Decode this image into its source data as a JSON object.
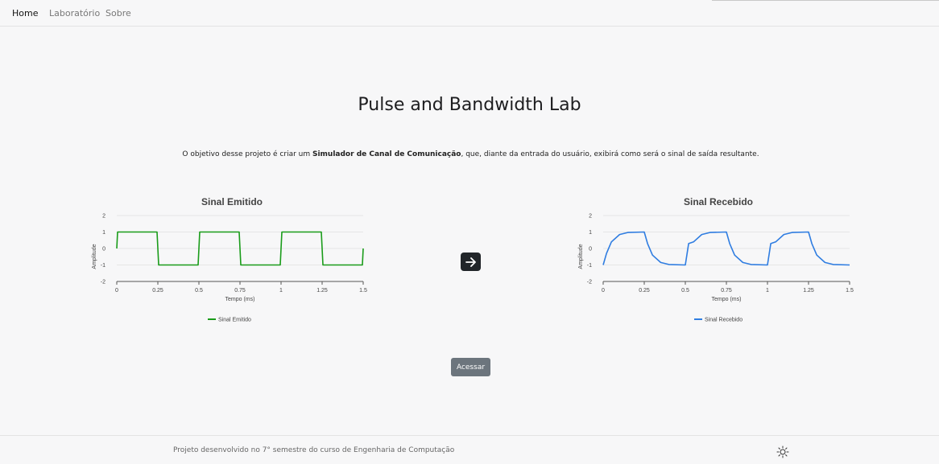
{
  "nav": {
    "items": [
      {
        "label": "Home",
        "active": true
      },
      {
        "label": "Laboratório",
        "active": false
      },
      {
        "label": "Sobre",
        "active": false
      }
    ]
  },
  "page": {
    "title": "Pulse and Bandwidth Lab",
    "description_prefix": "O objetivo desse projeto é criar um ",
    "description_bold": "Simulador de Canal de Comunicação",
    "description_suffix": ", que, diante da entrada do usuário, exibirá como será o sinal de saída resultante."
  },
  "actions": {
    "arrow_icon": "arrow-right-icon",
    "access_label": "Acessar"
  },
  "footer": {
    "text": "Projeto desenvolvido no 7° semestre do curso de Engenharia de Computação",
    "theme_icon": "sun-icon"
  },
  "chart_data": [
    {
      "type": "line",
      "title": "Sinal Emitido",
      "xlabel": "Tempo (ms)",
      "ylabel": "Amplitude",
      "xlim": [
        0,
        1.5
      ],
      "ylim": [
        -2,
        2
      ],
      "x_ticks": [
        "0",
        "0.25",
        "0.5",
        "0.75",
        "1",
        "1.25",
        "1.5"
      ],
      "y_ticks": [
        "2",
        "1",
        "0",
        "-1",
        "-2"
      ],
      "grid": true,
      "legend": "bottom",
      "series": [
        {
          "name": "Sinal Emitido",
          "color": "#1a9c1a",
          "x": [
            0,
            0.005,
            0.245,
            0.255,
            0.495,
            0.505,
            0.745,
            0.755,
            0.995,
            1.005,
            1.245,
            1.255,
            1.495,
            1.5
          ],
          "y": [
            0,
            1,
            1,
            -1,
            -1,
            1,
            1,
            -1,
            -1,
            1,
            1,
            -1,
            -1,
            0
          ]
        }
      ]
    },
    {
      "type": "line",
      "title": "Sinal Recebido",
      "xlabel": "Tempo (ms)",
      "ylabel": "Amplitude",
      "xlim": [
        0,
        1.5
      ],
      "ylim": [
        -2,
        2
      ],
      "x_ticks": [
        "0",
        "0.25",
        "0.5",
        "0.75",
        "1",
        "1.25",
        "1.5"
      ],
      "y_ticks": [
        "2",
        "1",
        "0",
        "-1",
        "-2"
      ],
      "grid": true,
      "legend": "bottom",
      "series": [
        {
          "name": "Sinal Recebido",
          "color": "#2f7de1",
          "x": [
            0,
            0.02,
            0.05,
            0.1,
            0.15,
            0.25,
            0.27,
            0.3,
            0.35,
            0.4,
            0.5,
            0.52,
            0.55,
            0.6,
            0.65,
            0.75,
            0.77,
            0.8,
            0.85,
            0.9,
            1.0,
            1.02,
            1.05,
            1.1,
            1.15,
            1.25,
            1.27,
            1.3,
            1.35,
            1.4,
            1.5
          ],
          "y": [
            -1,
            -0.3,
            0.4,
            0.85,
            0.97,
            1,
            0.3,
            -0.4,
            -0.85,
            -0.97,
            -1,
            0.3,
            0.4,
            0.85,
            0.97,
            1,
            0.3,
            -0.4,
            -0.85,
            -0.97,
            -1,
            0.3,
            0.4,
            0.85,
            0.97,
            1,
            0.3,
            -0.4,
            -0.85,
            -0.97,
            -1
          ]
        }
      ]
    }
  ]
}
